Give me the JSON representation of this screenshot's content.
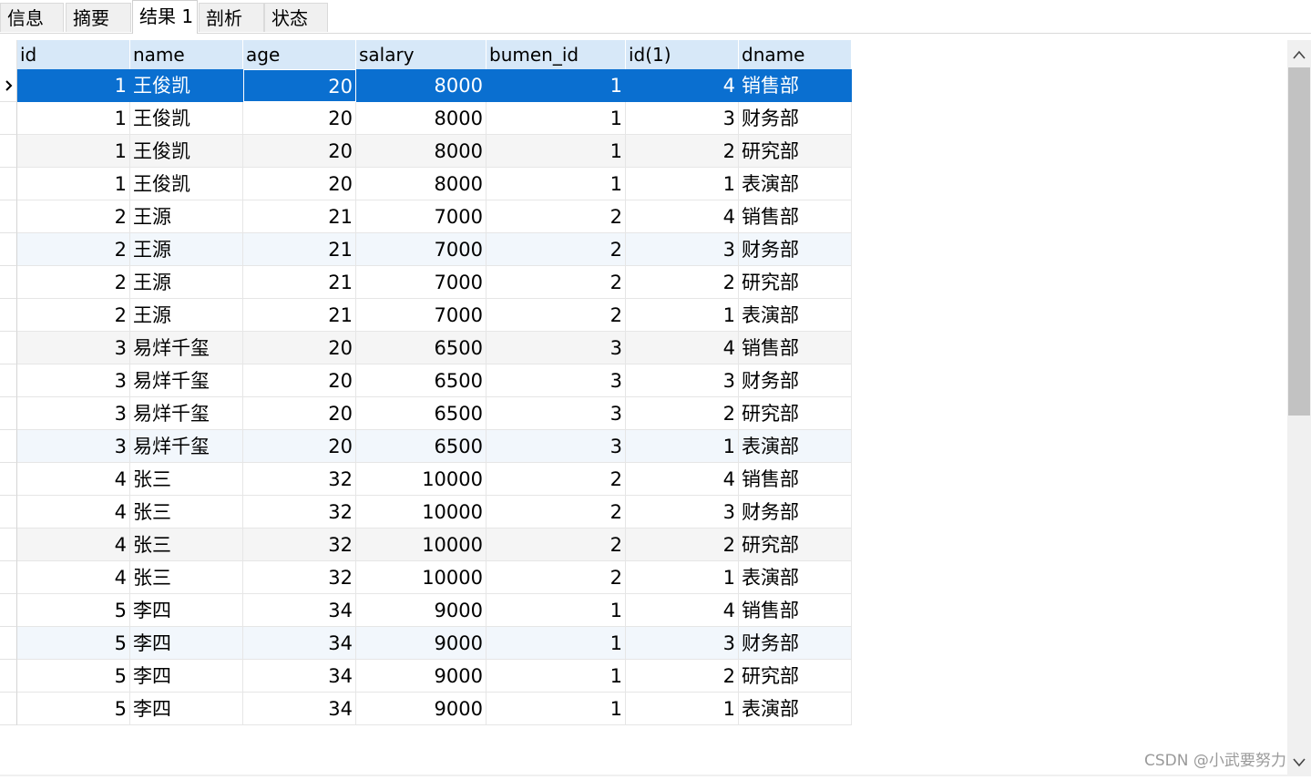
{
  "tabs": [
    {
      "label": "信息",
      "active": false
    },
    {
      "label": "摘要",
      "active": false
    },
    {
      "label": "结果 1",
      "active": true
    },
    {
      "label": "剖析",
      "active": false
    },
    {
      "label": "状态",
      "active": false
    }
  ],
  "columns": [
    "id",
    "name",
    "age",
    "salary",
    "bumen_id",
    "id(1)",
    "dname"
  ],
  "rows": [
    [
      "1",
      "王俊凯",
      "20",
      "8000",
      "1",
      "4",
      "销售部"
    ],
    [
      "1",
      "王俊凯",
      "20",
      "8000",
      "1",
      "3",
      "财务部"
    ],
    [
      "1",
      "王俊凯",
      "20",
      "8000",
      "1",
      "2",
      "研究部"
    ],
    [
      "1",
      "王俊凯",
      "20",
      "8000",
      "1",
      "1",
      "表演部"
    ],
    [
      "2",
      "王源",
      "21",
      "7000",
      "2",
      "4",
      "销售部"
    ],
    [
      "2",
      "王源",
      "21",
      "7000",
      "2",
      "3",
      "财务部"
    ],
    [
      "2",
      "王源",
      "21",
      "7000",
      "2",
      "2",
      "研究部"
    ],
    [
      "2",
      "王源",
      "21",
      "7000",
      "2",
      "1",
      "表演部"
    ],
    [
      "3",
      "易烊千玺",
      "20",
      "6500",
      "3",
      "4",
      "销售部"
    ],
    [
      "3",
      "易烊千玺",
      "20",
      "6500",
      "3",
      "3",
      "财务部"
    ],
    [
      "3",
      "易烊千玺",
      "20",
      "6500",
      "3",
      "2",
      "研究部"
    ],
    [
      "3",
      "易烊千玺",
      "20",
      "6500",
      "3",
      "1",
      "表演部"
    ],
    [
      "4",
      "张三",
      "32",
      "10000",
      "2",
      "4",
      "销售部"
    ],
    [
      "4",
      "张三",
      "32",
      "10000",
      "2",
      "3",
      "财务部"
    ],
    [
      "4",
      "张三",
      "32",
      "10000",
      "2",
      "2",
      "研究部"
    ],
    [
      "4",
      "张三",
      "32",
      "10000",
      "2",
      "1",
      "表演部"
    ],
    [
      "5",
      "李四",
      "34",
      "9000",
      "1",
      "4",
      "销售部"
    ],
    [
      "5",
      "李四",
      "34",
      "9000",
      "1",
      "3",
      "财务部"
    ],
    [
      "5",
      "李四",
      "34",
      "9000",
      "1",
      "2",
      "研究部"
    ],
    [
      "5",
      "李四",
      "34",
      "9000",
      "1",
      "1",
      "表演部"
    ]
  ],
  "selected_row": 0,
  "colors": {
    "header_bg": "#d7e8f8",
    "selection": "#0a6fd0",
    "scroll_thumb": "#c2c2c2"
  },
  "watermark": "CSDN @小武要努力"
}
